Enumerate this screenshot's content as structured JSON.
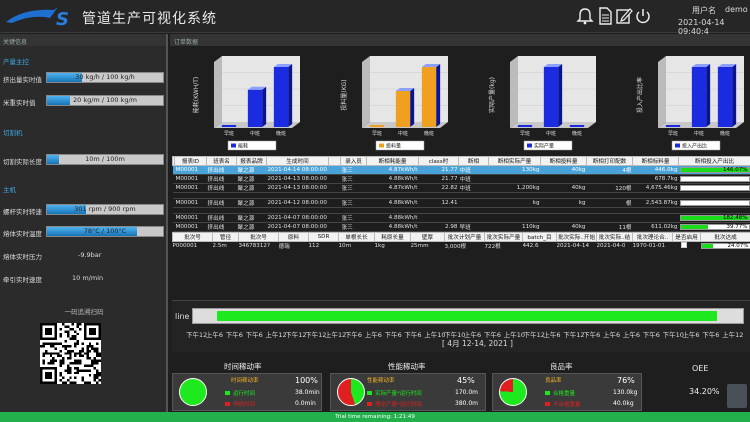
{
  "header": {
    "logo_text": "S",
    "title": "管道生产可视化系统",
    "user_label": "用户名",
    "user_name": "demo",
    "datetime": "2021-04-14 09:40:4",
    "icons": [
      "bell-icon",
      "document-icon",
      "edit-icon",
      "power-icon"
    ]
  },
  "left_panel": {
    "header": "关键信息",
    "sections": {
      "production": "产量主控",
      "cutting": "切割机",
      "host": "主机"
    },
    "rows": {
      "extrude_actual": {
        "label": "挤出量实时值",
        "value_text": "30 kg/h / 100 kg/h",
        "ratio": 0.3
      },
      "meter_weight": {
        "label": "米重实时值",
        "value_text": "20 kg/m / 100 kg/m",
        "ratio": 0.2
      },
      "cut_length": {
        "label": "切割实际长度",
        "value_text": "10m / 100m",
        "ratio": 0.1
      },
      "screw_speed": {
        "label": "螺杆实时转速",
        "value_text": "301 rpm / 900 rpm",
        "ratio": 0.334
      },
      "melt_temp": {
        "label": "熔体实时温度",
        "value_text": "78°C / 100°C",
        "ratio": 0.78
      },
      "melt_pressure": {
        "label": "熔体实时压力",
        "value_text": "-9.9bar"
      },
      "haul_speed": {
        "label": "牵引实时速度",
        "value_text": "10 m/min"
      }
    },
    "qr_title": "一码追溯扫码"
  },
  "main": {
    "header": "订单数据"
  },
  "chart_data": [
    {
      "type": "bar",
      "categories": [
        "早班",
        "中班",
        "晚班"
      ],
      "series": [
        {
          "name": "能耗",
          "values": [
            0,
            62,
            100
          ],
          "color": "#1a2be0"
        }
      ],
      "ylabel": "能耗(KWH/T)",
      "legend": "bottom"
    },
    {
      "type": "bar",
      "categories": [
        "早班",
        "中班",
        "晚班"
      ],
      "series": [
        {
          "name": "投料量",
          "values": [
            0,
            60,
            100
          ],
          "color": "#f0a020"
        }
      ],
      "ylabel": "投料量(KG)",
      "legend": "bottom"
    },
    {
      "type": "bar",
      "categories": [
        "早班",
        "中班",
        "晚班"
      ],
      "series": [
        {
          "name": "实际产量",
          "values": [
            0,
            100,
            0
          ],
          "color": "#1a2be0"
        }
      ],
      "ylabel": "实际产量(kg)",
      "legend": "bottom"
    },
    {
      "type": "bar",
      "categories": [
        "早班",
        "中班",
        "晚班"
      ],
      "series": [
        {
          "name": "投入产出比",
          "values": [
            0,
            100,
            100
          ],
          "color": "#1a2be0"
        }
      ],
      "ylabel": "投入产出比率",
      "legend": "bottom"
    }
  ],
  "order_table": {
    "headers": [
      "",
      "报表ID",
      "班表名",
      "报表品牌",
      "生成时间",
      "",
      "录入员",
      "断相耗能量",
      "class时",
      "断相",
      "断相实际产量",
      "断相投料量",
      "断相打印配数",
      "断相标料量",
      "断相投入产出比"
    ],
    "rows": [
      {
        "cells": [
          "",
          "M00001",
          "挤出线",
          "聚之源",
          "2021-04-14 08:00:00",
          "",
          "张三",
          "4.87kWh/t",
          "21.77",
          "中班",
          "130kg",
          "40kg",
          "4根",
          "446.0kg",
          ""
        ],
        "pct": 146.07,
        "pct_text": "146.07%",
        "selected": true
      },
      {
        "cells": [
          "",
          "M00001",
          "挤出线",
          "聚之源",
          "2021-04-13 08:00:00",
          "",
          "张三",
          "4.88kWh/t",
          "21.77",
          "中班",
          "",
          "",
          "",
          "678.7kg",
          ""
        ],
        "pct": 0,
        "pct_text": "",
        "selected": false
      },
      {
        "cells": [
          "",
          "M00001",
          "挤出线",
          "聚之源",
          "2021-04-13 08:00:00",
          "",
          "张三",
          "4.87kWh/t",
          "22.82",
          "中班",
          "1,200kg",
          "40kg",
          "120根",
          "4,675.46kg",
          ""
        ],
        "pct": 0,
        "pct_text": "",
        "selected": false
      },
      {
        "cells": [
          "",
          "",
          "",
          "",
          "",
          "",
          "",
          "",
          "",
          "",
          "",
          "",
          "",
          "",
          ""
        ],
        "gap": true
      },
      {
        "cells": [
          "",
          "M00001",
          "挤出线",
          "聚之源",
          "2021-04-12 08:00:00",
          "",
          "张三",
          "4.88kWh/t",
          "12.41",
          "",
          "kg",
          "kg",
          "根",
          "2,543.87kg",
          ""
        ],
        "pct": 0,
        "pct_text": "",
        "selected": false
      },
      {
        "cells": [
          "",
          "",
          "",
          "",
          "",
          "",
          "",
          "",
          "",
          "",
          "",
          "",
          "",
          "",
          ""
        ],
        "gap": true
      },
      {
        "cells": [
          "",
          "M00001",
          "挤出线",
          "聚之源",
          "2021-04-07 08:00:00",
          "",
          "张三",
          "4.88kWh/t",
          "",
          "",
          "",
          "",
          "",
          "",
          ""
        ],
        "pct": 182.48,
        "pct_text": "182.48%",
        "selected": false
      },
      {
        "cells": [
          "",
          "M00001",
          "挤出线",
          "聚之源",
          "2021-04-07 08:00:00",
          "",
          "张三",
          "4.88kWh/t",
          "2.98",
          "早班",
          "110kg",
          "40kg",
          "11根",
          "611.02kg",
          ""
        ],
        "pct": 39.77,
        "pct_text": "39.77%",
        "selected": false
      }
    ]
  },
  "param_table": {
    "headers": [
      "批次号",
      "管径",
      "批次号",
      "原料",
      "SDR",
      "单根长长",
      "耗原长量",
      "壁厚",
      "批次计划产量",
      "批次实际产量",
      "batch_目",
      "批次实际..开始",
      "批次实际..结",
      "批次理论合..",
      "是否启用",
      "批次达成"
    ],
    "row": [
      "P000001",
      "2.5m",
      "34678312?",
      "德瑞",
      "112",
      "10m",
      "1kg",
      "25mm",
      "3,000根",
      "722根",
      "442.6",
      "2021-04-14",
      "2021-04-0",
      "1970-01-01",
      "",
      ""
    ],
    "pct": 24.07,
    "pct_text": "24.07%"
  },
  "timeline": {
    "label": "line",
    "ticks": [
      "下午12",
      "上午6",
      "下午6",
      "下午6",
      "上午12",
      "下午12",
      "下午12",
      "上午12",
      "下午6",
      "上午6",
      "下午6",
      "下午6",
      "上午10",
      "下午10",
      "上午6",
      "下午6",
      "上午10",
      "下午12",
      "上午6",
      "下午12",
      "下午6",
      "上午6",
      "上午6",
      "下午6",
      "下午10",
      "上午6",
      "下午6",
      "上午12"
    ],
    "range": "[ 4月 12-14, 2021 ]",
    "progress": 0.905
  },
  "stats": {
    "time_util": {
      "title": "时间稼动率",
      "header": "时间稼动率",
      "percent": "100%",
      "percent_value": 100,
      "rows": [
        {
          "label": "运行时间",
          "value": "38.0min",
          "color": "#1ee81e"
        },
        {
          "label": "停机时间",
          "value": "0.0min",
          "color": "#e02020"
        }
      ]
    },
    "perf_util": {
      "title": "性能稼动率",
      "header": "性能稼动率",
      "percent": "45%",
      "percent_value": 45,
      "rows": [
        {
          "label": "实际产量*运行时间",
          "value": "170.0m",
          "color": "#1ee81e"
        },
        {
          "label": "理论产量*运行时间",
          "value": "380.0m",
          "color": "#e02020"
        }
      ]
    },
    "yield": {
      "title": "良品率",
      "header": "良品率",
      "percent": "76%",
      "percent_value": 76,
      "rows": [
        {
          "label": "合格重量",
          "value": "130.0kg",
          "color": "#1ee81e"
        },
        {
          "label": "不合格重量",
          "value": "40.0kg",
          "color": "#e02020"
        }
      ]
    }
  },
  "oee": {
    "title": "OEE",
    "value": "34.20%"
  },
  "trial": {
    "text": "Trial time remaining: 1:21:49"
  },
  "colors": {
    "accent": "#3fa7e1",
    "green": "#1ee81e",
    "red": "#e02020",
    "bar_blue": "#1a2be0",
    "bar_orange": "#f0a020"
  }
}
